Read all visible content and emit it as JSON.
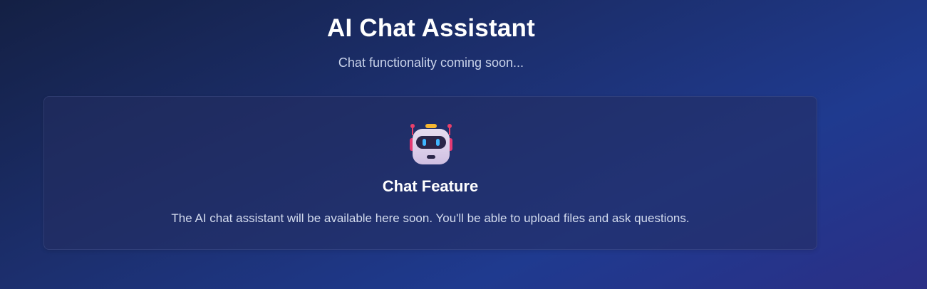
{
  "header": {
    "title": "AI Chat Assistant",
    "subtitle": "Chat functionality coming soon..."
  },
  "card": {
    "icon": "robot-icon",
    "title": "Chat Feature",
    "description": "The AI chat assistant will be available here soon. You'll be able to upload files and ask questions."
  },
  "colors": {
    "background_start": "#142044",
    "background_end": "#2b2f86",
    "card_background": "#242e60",
    "text_primary": "#ffffff",
    "text_secondary": "#c9d3ea"
  }
}
